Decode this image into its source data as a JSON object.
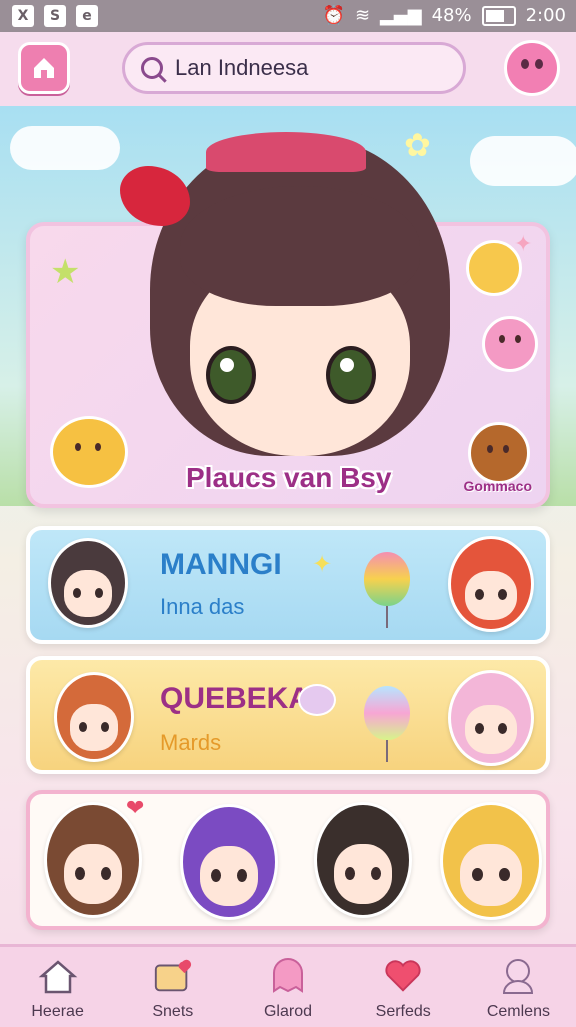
{
  "status_bar": {
    "left_icons": [
      "X",
      "S",
      "e"
    ],
    "battery_text": "48%",
    "time": "2:00",
    "icons": [
      "alarm-icon",
      "wifi-icon",
      "signal-icon",
      "battery-icon"
    ]
  },
  "header": {
    "home_icon": "home-icon",
    "search_text": "Lan Indneesa",
    "mascot_icon": "pink-mascot-icon"
  },
  "hero": {
    "title": "Plaucs van Bsy",
    "subtitle": "Gommaco"
  },
  "rows": [
    {
      "title": "MANNGI",
      "subtitle": "Inna das",
      "title_color": "#2b7fc9",
      "sub_color": "#2b7fc9"
    },
    {
      "title": "QUEBEKA",
      "subtitle": "Mards",
      "title_color": "#9c2f86",
      "sub_color": "#e59a2a"
    }
  ],
  "bottom_nav": [
    {
      "label": "Heerae",
      "icon": "house-icon"
    },
    {
      "label": "Snets",
      "icon": "card-icon"
    },
    {
      "label": "Glarod",
      "icon": "ghost-icon"
    },
    {
      "label": "Serfeds",
      "icon": "heart-icon"
    },
    {
      "label": "Cemlens",
      "icon": "character-icon"
    }
  ],
  "colors": {
    "accent_pink": "#ee7fb0",
    "topbar": "#f6dced",
    "nav": "#f6d3e7"
  }
}
